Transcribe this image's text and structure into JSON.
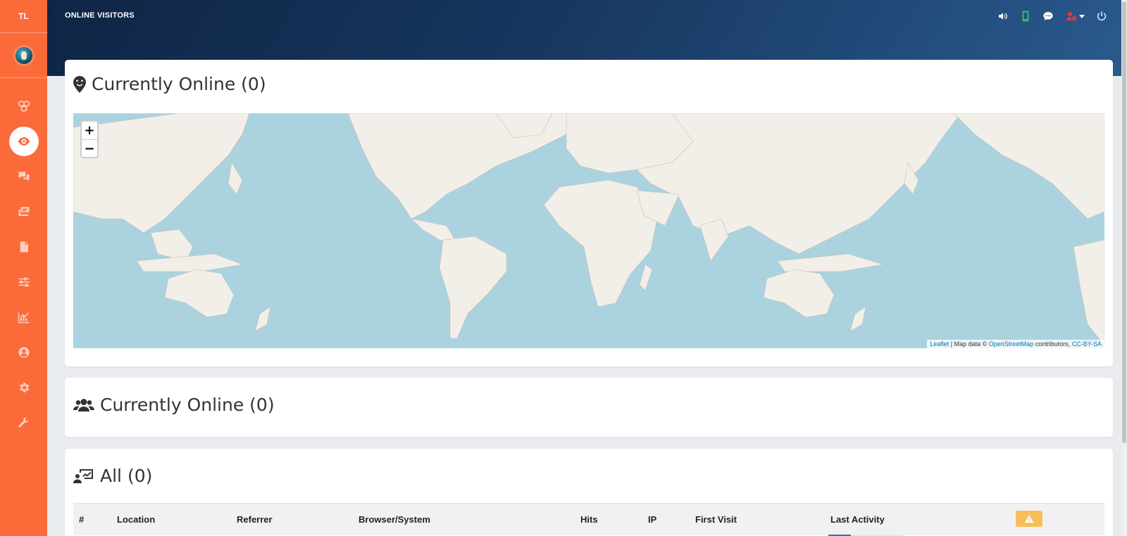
{
  "sidebar": {
    "brand": "TL",
    "items": [
      {
        "icon": "cubes-icon",
        "active": false
      },
      {
        "icon": "eye-icon",
        "active": true
      },
      {
        "icon": "chat-bubbles-icon",
        "active": false
      },
      {
        "icon": "tickets-icon",
        "active": false
      },
      {
        "icon": "document-icon",
        "active": false
      },
      {
        "icon": "sliders-icon",
        "active": false
      },
      {
        "icon": "chart-icon",
        "active": false
      },
      {
        "icon": "user-circle-icon",
        "active": false
      },
      {
        "icon": "gear-icon",
        "active": false
      },
      {
        "icon": "wrench-icon",
        "active": false
      }
    ]
  },
  "header": {
    "title": "ONLINE VISITORS",
    "icons": [
      "volume-icon",
      "mobile-icon",
      "comment-icon",
      "user-alert-icon",
      "power-icon"
    ],
    "colors": {
      "mobile": "#34c759",
      "user_alert": "#e8373f",
      "default": "#ffffff"
    }
  },
  "map_card": {
    "title": "Currently Online (0)",
    "zoom_in": "+",
    "zoom_out": "−",
    "attribution": {
      "leaflet": "Leaflet",
      "sep": " | Map data © ",
      "osm": "OpenStreetMap",
      "contributors": " contributors, ",
      "license": "CC-BY-SA"
    }
  },
  "online_card": {
    "title": "Currently Online (0)"
  },
  "all_card": {
    "title": "All (0)",
    "columns": [
      "#",
      "Location",
      "Referrer",
      "Browser/System",
      "Hits",
      "IP",
      "First Visit",
      "Last Activity"
    ]
  },
  "colors": {
    "sidebar": "#fb6b3a",
    "header_start": "#0f2545",
    "header_end": "#2a5a8e",
    "map_water": "#aad3df",
    "map_land": "#f2efe9",
    "warning_button": "#f7be57"
  }
}
